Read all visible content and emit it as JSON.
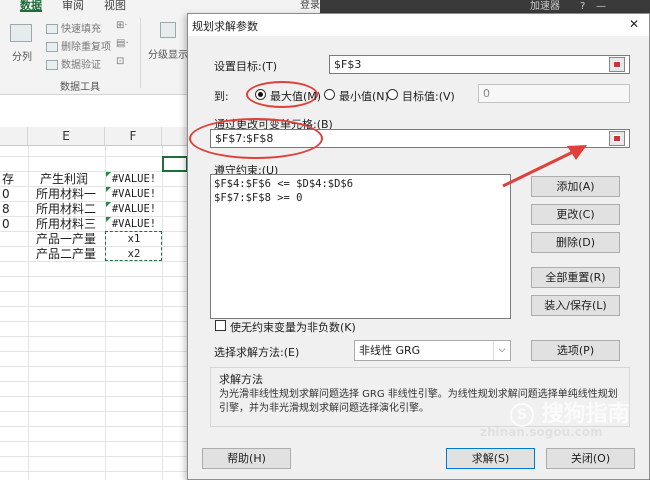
{
  "ribbon": {
    "tabs": [
      "数据",
      "审阅",
      "视图"
    ],
    "login_text": "登录",
    "top_right_text": "加速器",
    "tools": {
      "split_label": "分列",
      "flash_fill": "快速填充",
      "remove_dupes": "删除重复项",
      "data_validation": "数据验证",
      "outline_label": "分级显示",
      "group_caption": "数据工具"
    }
  },
  "sheet": {
    "columns": [
      "E",
      "F"
    ],
    "rows": [
      {
        "d": "存",
        "e": "产生利润",
        "f": "#VALUE!"
      },
      {
        "d": "0",
        "e": "所用材料一",
        "f": "#VALUE!"
      },
      {
        "d": "8",
        "e": "所用材料二",
        "f": "#VALUE!"
      },
      {
        "d": "0",
        "e": "所用材料三",
        "f": "#VALUE!"
      },
      {
        "d": "",
        "e": "产品一产量",
        "f": "x1"
      },
      {
        "d": "",
        "e": "产品二产量",
        "f": "x2"
      }
    ]
  },
  "dialog": {
    "title": "规划求解参数",
    "close_glyph": "✕",
    "objective_label": "设置目标:(T)",
    "objective_value": "$F$3",
    "to_label": "到:",
    "opt_max": "最大值(M)",
    "opt_min": "最小值(N)",
    "opt_value": "目标值:(V)",
    "target_value": "0",
    "variable_label": "通过更改可变单元格:(B)",
    "variable_value": "$F$7:$F$8",
    "constraints_label": "遵守约束:(U)",
    "constraints": [
      "$F$4:$F$6 <= $D$4:$D$6",
      "$F$7:$F$8 >= 0"
    ],
    "btn_add": "添加(A)",
    "btn_change": "更改(C)",
    "btn_delete": "删除(D)",
    "btn_reset": "全部重置(R)",
    "btn_loadsave": "装入/保存(L)",
    "nonneg_label": "使无约束变量为非负数(K)",
    "method_label": "选择求解方法:(E)",
    "method_value": "非线性 GRG",
    "btn_options": "选项(P)",
    "solving_title": "求解方法",
    "solving_text": "为光滑非线性规划求解问题选择 GRG 非线性引擎。为线性规划求解问题选择单纯线性规划引擎，并为非光滑规划求解问题选择演化引擎。",
    "btn_help": "帮助(H)",
    "btn_solve": "求解(S)",
    "btn_close": "关闭(O)"
  },
  "watermark": {
    "brand": "搜狗指南",
    "url": "zhinan.sogou.com"
  },
  "colors": {
    "annotation_red": "#e0403a",
    "excel_green": "#1d6e3a"
  }
}
